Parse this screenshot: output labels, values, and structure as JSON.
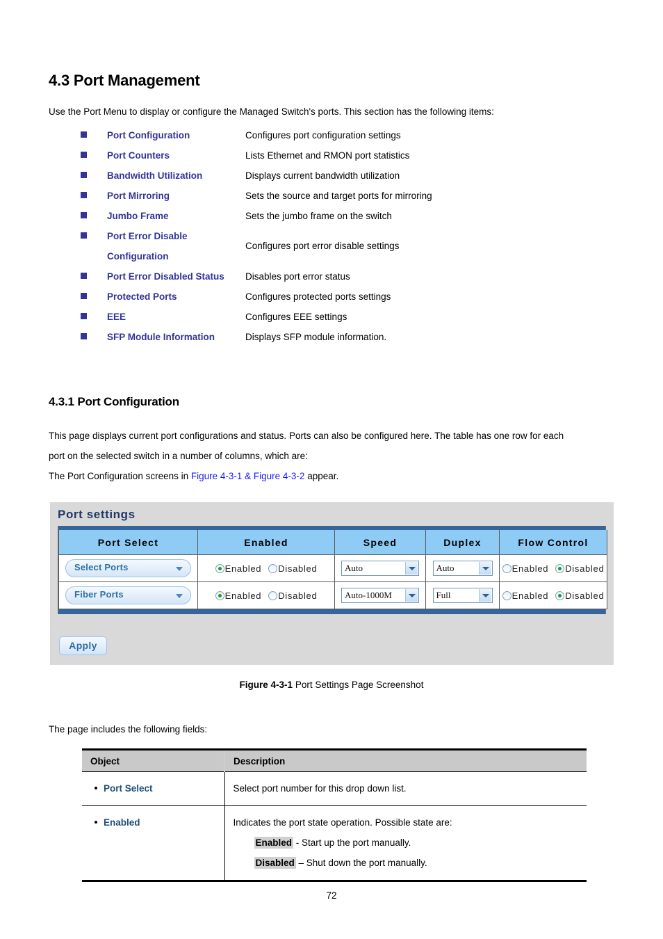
{
  "section": {
    "heading": "4.3 Port Management",
    "intro": "Use the Port Menu to display or configure the Managed Switch's ports. This section has the following items:"
  },
  "menu_items": [
    {
      "name": "Port Configuration",
      "name2": "",
      "desc": "Configures port configuration settings"
    },
    {
      "name": "Port Counters",
      "name2": "",
      "desc": "Lists Ethernet and RMON port statistics"
    },
    {
      "name": "Bandwidth Utilization",
      "name2": "",
      "desc": "Displays current bandwidth utilization"
    },
    {
      "name": "Port Mirroring",
      "name2": "",
      "desc": "Sets the source and target ports for mirroring"
    },
    {
      "name": "Jumbo Frame",
      "name2": "",
      "desc": "Sets the jumbo frame on the switch"
    },
    {
      "name": "Port Error Disable",
      "name2": "Configuration",
      "desc": "Configures port error disable settings"
    },
    {
      "name": "Port Error Disabled Status",
      "name2": "",
      "desc": "Disables port error status"
    },
    {
      "name": "Protected Ports",
      "name2": "",
      "desc": "Configures protected ports settings"
    },
    {
      "name": "EEE",
      "name2": "",
      "desc": "Configures EEE settings"
    },
    {
      "name": "SFP Module Information",
      "name2": "",
      "desc": "Displays SFP module information."
    }
  ],
  "subsection": {
    "heading": "4.3.1 Port Configuration",
    "para1": "This page displays current port configurations and status. Ports can also be configured here. The table has one row for each",
    "para2": "port on the selected switch in a number of columns, which are:",
    "para3_pre": "The Port Configuration screens in ",
    "para3_link": "Figure 4-3-1 & Figure 4-3-2",
    "para3_post": " appear."
  },
  "screenshot": {
    "title": "Port settings",
    "columns": [
      "Port Select",
      "Enabled",
      "Speed",
      "Duplex",
      "Flow Control"
    ],
    "rows": [
      {
        "port_select": "Select Ports",
        "enabled": {
          "enabled_label": "Enabled",
          "disabled_label": "Disabled",
          "selected": "Enabled"
        },
        "speed": "Auto",
        "duplex": "Auto",
        "flow_control": {
          "enabled_label": "Enabled",
          "disabled_label": "Disabled",
          "selected": "Disabled"
        }
      },
      {
        "port_select": "Fiber Ports",
        "enabled": {
          "enabled_label": "Enabled",
          "disabled_label": "Disabled",
          "selected": "Enabled"
        },
        "speed": "Auto-1000M",
        "duplex": "Full",
        "flow_control": {
          "enabled_label": "Enabled",
          "disabled_label": "Disabled",
          "selected": "Disabled"
        }
      }
    ],
    "apply_label": "Apply",
    "colors": {
      "header_blue": "#8ecbf5",
      "bar_blue": "#36659b",
      "panel_gray": "#d9d9d9",
      "title_navy": "#1f3864",
      "radio_green": "#18a018"
    }
  },
  "figure": {
    "label": "Figure 4-3-1",
    "caption": " Port Settings Page Screenshot"
  },
  "fields_intro": "The page includes the following fields:",
  "desc_table": {
    "headers": [
      "Object",
      "Description"
    ],
    "rows": [
      {
        "object": "Port Select",
        "lines": [
          "Select port number for this drop down list."
        ],
        "extra": []
      },
      {
        "object": "Enabled",
        "lines": [
          "Indicates the port state operation. Possible state are:"
        ],
        "extra": [
          {
            "hl": "Enabled",
            "rest": " - Start up the port manually."
          },
          {
            "hl": "Disabled",
            "rest": " – Shut down the port manually."
          }
        ]
      }
    ]
  },
  "page_number": "72"
}
